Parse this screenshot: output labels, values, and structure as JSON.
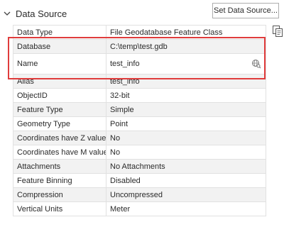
{
  "section": {
    "title": "Data Source",
    "set_button_label": "Set Data Source..."
  },
  "rows": [
    {
      "key": "Data Type",
      "value": "File Geodatabase Feature Class"
    },
    {
      "key": "Database",
      "value": "C:\\temp\\test.gdb"
    },
    {
      "key": "Name",
      "value": "test_info"
    },
    {
      "key": "Alias",
      "value": "test_info"
    },
    {
      "key": "ObjectID",
      "value": "32-bit"
    },
    {
      "key": "Feature Type",
      "value": "Simple"
    },
    {
      "key": "Geometry Type",
      "value": "Point"
    },
    {
      "key": "Coordinates have Z value",
      "value": "No"
    },
    {
      "key": "Coordinates have M value",
      "value": "No"
    },
    {
      "key": "Attachments",
      "value": "No Attachments"
    },
    {
      "key": "Feature Binning",
      "value": "Disabled"
    },
    {
      "key": "Compression",
      "value": "Uncompressed"
    },
    {
      "key": "Vertical Units",
      "value": "Meter"
    }
  ],
  "icons": {
    "collapse": "chevron-down-icon",
    "side": "copy-icon",
    "name_field": "globe-search-icon"
  },
  "colors": {
    "highlight": "#e03c3c",
    "row_shade": "#f2f2f2",
    "grid_line": "#e1e1e1"
  }
}
